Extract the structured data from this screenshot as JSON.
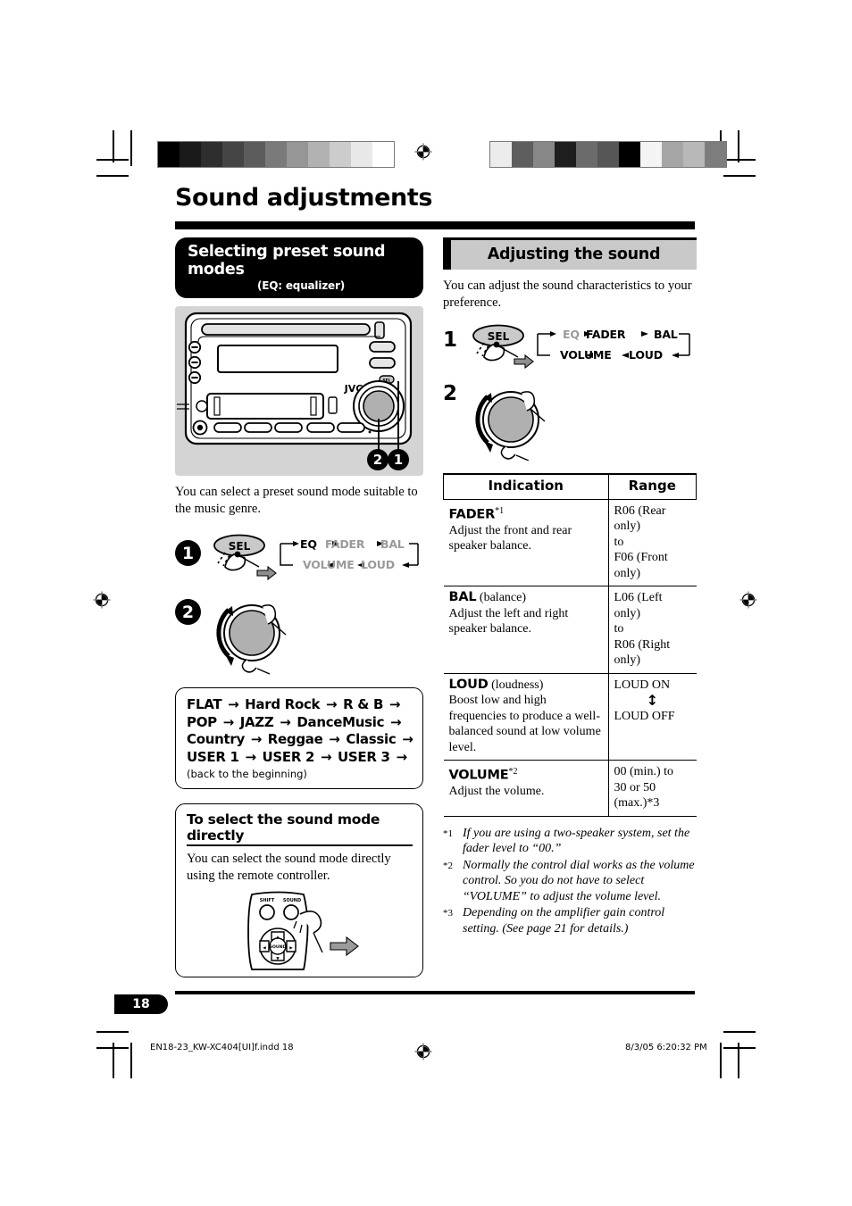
{
  "page": {
    "title": "Sound adjustments",
    "number": "18",
    "footer_file": "EN18-23_KW-XC404[UI]f.indd   18",
    "footer_timestamp": "8/3/05   6:20:32 PM"
  },
  "colors": {
    "header_black": "#000000",
    "header_gray_fill": "#c9c9c9",
    "illustration_gray": "#d4d4d4",
    "dim_text": "#9a9a9a",
    "knob_gray": "#b0b0b0"
  },
  "left_column": {
    "header": {
      "line1": "Selecting preset sound modes",
      "line2": "(EQ: equalizer)"
    },
    "unit_illustration": {
      "brand_label": "JVC",
      "callouts": [
        "2",
        "1"
      ]
    },
    "intro": "You can select a preset sound mode suitable to the music genre.",
    "step1": {
      "number": "1",
      "button_label": "SEL",
      "flow_top": [
        "EQ",
        "FADER",
        "BAL"
      ],
      "flow_bottom": [
        "VOLUME",
        "LOUD"
      ],
      "active_item": "EQ"
    },
    "step2": {
      "number": "2"
    },
    "mode_list": {
      "rows": [
        [
          "FLAT",
          "Hard Rock",
          "R & B"
        ],
        [
          "POP",
          "JAZZ",
          "DanceMusic"
        ],
        [
          "Country",
          "Reggae",
          "Classic"
        ],
        [
          "USER 1",
          "USER 2",
          "USER 3"
        ]
      ],
      "note": "(back to the beginning)"
    },
    "remote_section": {
      "title": "To select the sound mode directly",
      "body": "You can select the sound mode directly using the remote controller.",
      "remote_labels": {
        "top_left": "SHIFT",
        "top_right": "SOUND",
        "center": "SOUND"
      }
    }
  },
  "right_column": {
    "header": "Adjusting the sound",
    "intro": "You can adjust the sound characteristics to your preference.",
    "step1": {
      "number": "1",
      "button_label": "SEL",
      "flow_top": [
        "EQ",
        "FADER",
        "BAL"
      ],
      "flow_bottom": [
        "VOLUME",
        "LOUD"
      ],
      "dim_item": "EQ"
    },
    "step2": {
      "number": "2"
    },
    "table": {
      "headers": [
        "Indication",
        "Range"
      ],
      "rows": [
        {
          "name": "FADER",
          "name_sup": "*1",
          "desc": "Adjust the front and rear speaker balance.",
          "range": "R06 (Rear only)\nto\nF06 (Front only)"
        },
        {
          "name": "BAL",
          "name_extra": " (balance)",
          "desc": "Adjust the left and right speaker balance.",
          "range": "L06 (Left only)\nto\nR06 (Right only)"
        },
        {
          "name": "LOUD",
          "name_extra": " (loudness)",
          "desc": "Boost low and high frequencies to produce a well-balanced sound at low volume level.",
          "range_top": "LOUD ON",
          "range_arrow": "↕",
          "range_bottom": "LOUD OFF"
        },
        {
          "name": "VOLUME",
          "name_sup": "*2",
          "desc": "Adjust the volume.",
          "range": "00 (min.) to\n30 or 50 (max.)*3"
        }
      ]
    },
    "footnotes": [
      {
        "marker": "*1",
        "text": "If you are using a two-speaker system, set the fader level to “00.”"
      },
      {
        "marker": "*2",
        "text": "Normally the control dial works as the volume control. So you do not have to select “VOLUME” to adjust the volume level."
      },
      {
        "marker": "*3",
        "text": "Depending on the amplifier gain control setting. (See page 21 for details.)"
      }
    ]
  },
  "print_marks": {
    "gray_strip_left": [
      "#000000",
      "#1a1a1a",
      "#2e2e2e",
      "#454545",
      "#5c5c5c",
      "#7a7a7a",
      "#969696",
      "#b2b2b2",
      "#cccccc",
      "#e8e8e8",
      "#ffffff"
    ],
    "gray_strip_right": [
      "#ececec",
      "#5e5e5e",
      "#878787",
      "#1e1e1e",
      "#6b6b6b",
      "#565656",
      "#000000",
      "#f4f4f4",
      "#a5a5a5",
      "#b8b8b8",
      "#7d7d7d"
    ]
  }
}
